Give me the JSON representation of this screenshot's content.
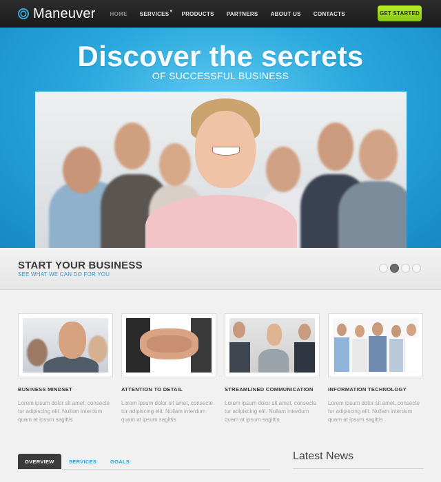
{
  "brand": {
    "name": "Maneuver"
  },
  "nav": {
    "items": [
      {
        "label": "HOME",
        "active": true
      },
      {
        "label": "SERVICES",
        "has_dropdown": true
      },
      {
        "label": "PRODUCTS"
      },
      {
        "label": "PARTNERS"
      },
      {
        "label": "ABOUT US"
      },
      {
        "label": "CONTACTS"
      }
    ],
    "cta_label": "GET STARTED"
  },
  "hero": {
    "title": "Discover the secrets",
    "subtitle": "OF SUCCESSFUL BUSINESS"
  },
  "band": {
    "title": "START YOUR BUSINESS",
    "subtitle": "SEE WHAT WE CAN DO FOR YOU",
    "slider_dots": 4,
    "active_dot": 2
  },
  "features": [
    {
      "title": "BUSINESS MINDSET",
      "text": "Lorem ipsum dolor sit amet, consecte tur adipiscing elit. Nullam interdum quam at ipsum sagittis"
    },
    {
      "title": "ATTENTION TO DETAIL",
      "text": "Lorem ipsum dolor sit amet, consecte tur adipiscing elit. Nullam interdum quam at ipsum sagittis"
    },
    {
      "title": "STREAMLINED COMMUNICATION",
      "text": "Lorem ipsum dolor sit amet, consecte tur adipiscing elit. Nullam interdum quam at ipsum sagittis"
    },
    {
      "title": "INFORMATION TECHNOLOGY",
      "text": "Lorem ipsum dolor sit amet, consecte tur adipiscing elit. Nullam interdum quam at ipsum sagittis"
    }
  ],
  "tabs": [
    {
      "label": "OVERVIEW",
      "active": true
    },
    {
      "label": "SERVICES"
    },
    {
      "label": "GOALS"
    }
  ],
  "news": {
    "title": "Latest News"
  },
  "colors": {
    "accent": "#2b9fd8",
    "cta": "#9ed61f",
    "topbar": "#222222"
  }
}
